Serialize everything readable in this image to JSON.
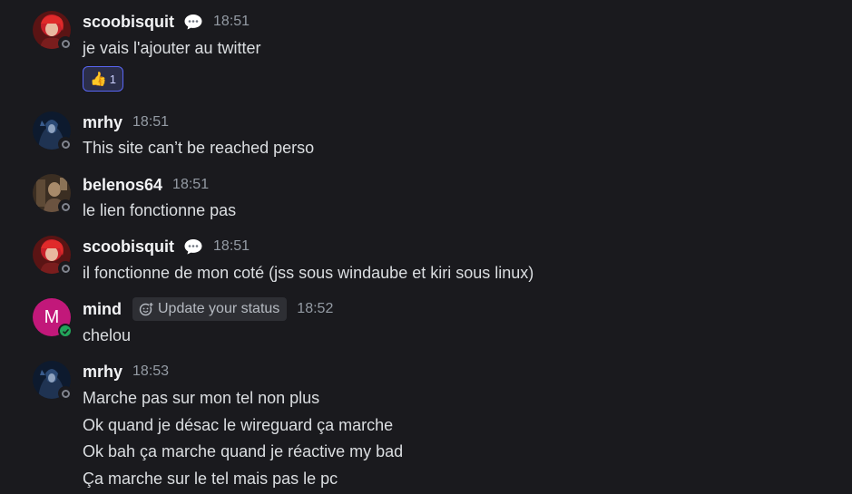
{
  "messages": [
    {
      "author": "scoobisquit",
      "time": "18:51",
      "avatar": "red-haired-warrior-avatar",
      "presence": "offline",
      "lines": [
        "je vais l'ajouter au twitter"
      ],
      "reaction": {
        "emoji": "👍",
        "count": "1"
      }
    },
    {
      "author": "mrhy",
      "time": "18:51",
      "avatar": "dark-hooded-figure-avatar",
      "presence": "offline",
      "lines": [
        "This site can’t be reached perso"
      ]
    },
    {
      "author": "belenos64",
      "time": "18:51",
      "avatar": "brown-portrait-avatar",
      "presence": "offline",
      "lines": [
        "le lien fonctionne pas"
      ]
    },
    {
      "author": "scoobisquit",
      "time": "18:51",
      "avatar": "red-haired-warrior-avatar",
      "presence": "offline",
      "lines": [
        "il fonctionne de mon coté (jss sous windaube et kiri sous linux)"
      ]
    },
    {
      "author": "mind",
      "time": "18:52",
      "avatar_letter": "M",
      "avatar_color": "#c2187a",
      "presence": "online",
      "status_prompt": "Update your status",
      "lines": [
        "chelou"
      ]
    },
    {
      "author": "mrhy",
      "time": "18:53",
      "avatar": "dark-hooded-figure-avatar",
      "presence": "offline",
      "lines": [
        "Marche pas sur mon tel non plus",
        "Ok quand je désac le wireguard ça marche",
        "Ok bah ça marche quand je réactive my bad",
        "Ça marche sur le tel mais pas le pc"
      ]
    }
  ],
  "colors": {
    "background": "#1a1a1e",
    "username": "#f2f3f5",
    "text": "#dbdee1",
    "timestamp": "#949ba4",
    "online": "#23a55a",
    "reaction_border": "#5865f2"
  }
}
